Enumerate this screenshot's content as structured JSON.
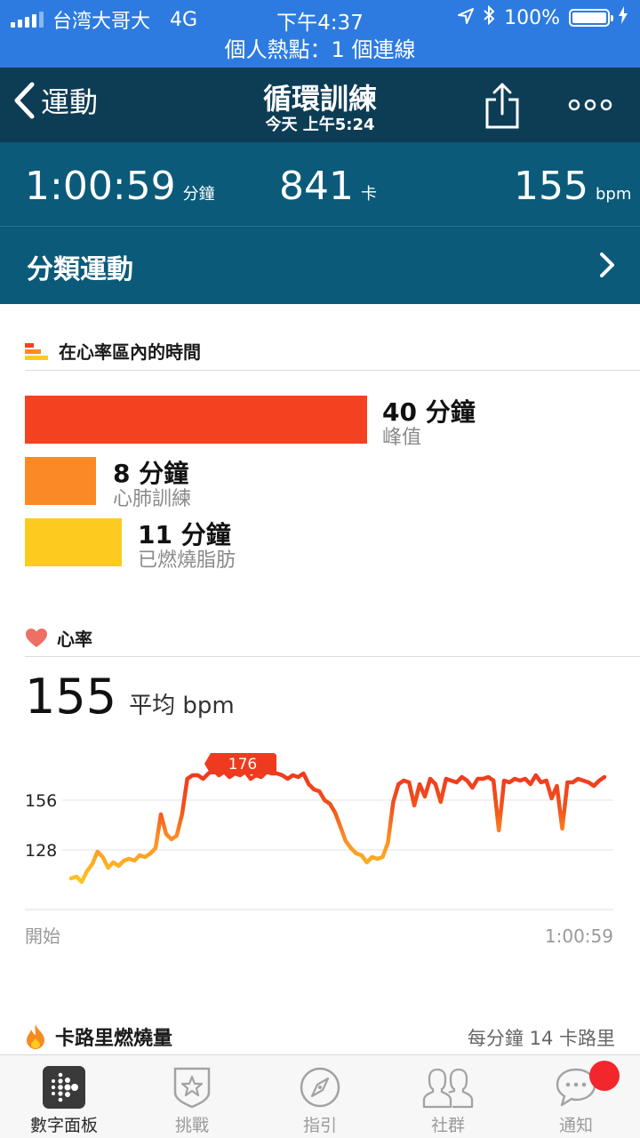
{
  "status_bar": {
    "carrier": "台湾大哥大",
    "network": "4G",
    "time": "下午4:37",
    "battery": "100%"
  },
  "hotspot": "個人熱點：1 個連線",
  "nav": {
    "back_label": "運動",
    "title": "循環訓練",
    "subtitle": "今天 上午5:24"
  },
  "summary": {
    "duration": "1:00:59",
    "duration_unit": "分鐘",
    "calories": "841",
    "calories_unit": "卡",
    "heart_rate": "155",
    "heart_rate_unit": "bpm",
    "category": "分類運動"
  },
  "zones": {
    "title": "在心率區內的時間",
    "items": [
      {
        "value": "40 分鐘",
        "label": "峰值",
        "minutes": 40,
        "color": "#f4411f"
      },
      {
        "value": "8 分鐘",
        "label": "心肺訓練",
        "minutes": 8,
        "color": "#fb8a26"
      },
      {
        "value": "11 分鐘",
        "label": "已燃燒脂肪",
        "minutes": 11,
        "color": "#fdcb20"
      }
    ]
  },
  "heart_rate": {
    "title": "心率",
    "average": "155",
    "average_unit": "平均 bpm",
    "chart_data": {
      "type": "line",
      "y_ticks": [
        "156",
        "128"
      ],
      "ylim": [
        96,
        181
      ],
      "x_start_label": "開始",
      "x_end_label": "1:00:59",
      "peak_label": "176",
      "series": [
        {
          "values": [
            112,
            113,
            110,
            116,
            120,
            127,
            124,
            118,
            121,
            119,
            122,
            123,
            122,
            125,
            124,
            126,
            129,
            148,
            137,
            134,
            136,
            148,
            168,
            170,
            170,
            168,
            171,
            173,
            170,
            172,
            169,
            171,
            170,
            172,
            168,
            170,
            169,
            172,
            171,
            171,
            170,
            168,
            170,
            169,
            171,
            165,
            162,
            161,
            156,
            154,
            149,
            141,
            133,
            129,
            126,
            125,
            121,
            124,
            123,
            124,
            132,
            155,
            165,
            167,
            166,
            153,
            165,
            158,
            168,
            165,
            155,
            168,
            167,
            166,
            169,
            167,
            163,
            168,
            168,
            169,
            167,
            139,
            167,
            166,
            168,
            167,
            168,
            165,
            170,
            166,
            167,
            157,
            164,
            140,
            166,
            166,
            168,
            167,
            166,
            164,
            167,
            169
          ]
        }
      ]
    }
  },
  "calories_burned": {
    "title": "卡路里燃燒量",
    "rate": "每分鐘 14 卡路里"
  },
  "tabs": [
    {
      "label": "數字面板"
    },
    {
      "label": "挑戰"
    },
    {
      "label": "指引"
    },
    {
      "label": "社群"
    },
    {
      "label": "通知"
    }
  ],
  "colors": {
    "nav": "#0d3c55",
    "summary": "#0b5a79",
    "status": "#2d7be0",
    "peak": "#f4411f",
    "cardio": "#fb8a26",
    "fat_burn": "#fdcb20"
  }
}
